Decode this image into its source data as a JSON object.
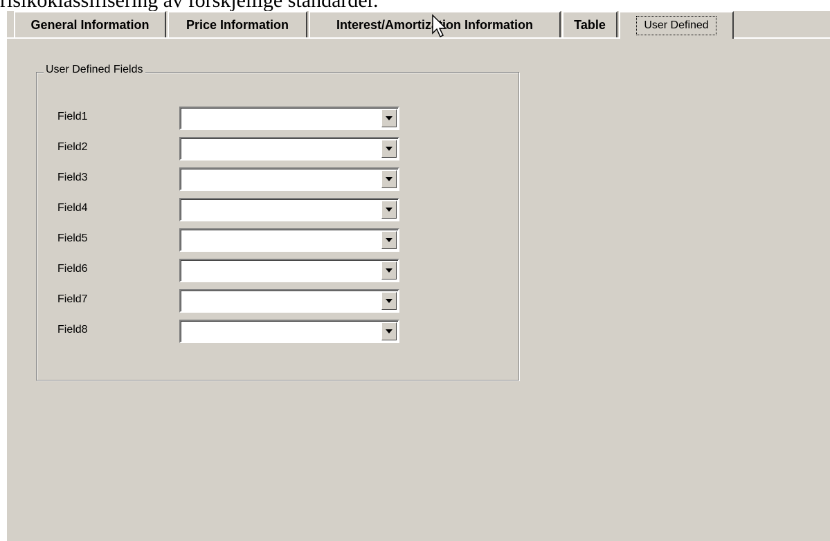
{
  "document": {
    "partial_text": "risikoklassifisering av forskjellige standarder."
  },
  "tabs": [
    {
      "label": "General Information"
    },
    {
      "label": "Price Information"
    },
    {
      "label": "Interest/Amortization Information"
    },
    {
      "label": "Table"
    },
    {
      "label": "User Defined",
      "selected": true
    }
  ],
  "group": {
    "title": "User Defined Fields"
  },
  "fields": [
    {
      "label": "Field1",
      "value": ""
    },
    {
      "label": "Field2",
      "value": ""
    },
    {
      "label": "Field3",
      "value": ""
    },
    {
      "label": "Field4",
      "value": ""
    },
    {
      "label": "Field5",
      "value": ""
    },
    {
      "label": "Field6",
      "value": ""
    },
    {
      "label": "Field7",
      "value": ""
    },
    {
      "label": "Field8",
      "value": ""
    }
  ],
  "colors": {
    "dialog_background": "#d4d0c8",
    "field_background": "#ffffff"
  },
  "icons": {
    "dropdown": "chevron-down-icon",
    "cursor": "mouse-pointer-icon"
  }
}
